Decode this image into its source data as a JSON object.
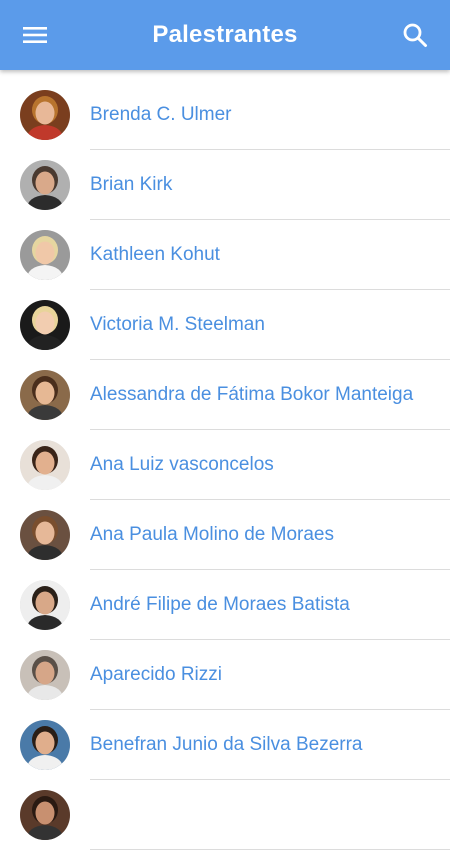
{
  "header": {
    "title": "Palestrantes",
    "menu_icon": "menu-icon",
    "search_icon": "search-icon",
    "bar_color": "#5b9bea"
  },
  "speakers": [
    {
      "name": "Brenda C. Ulmer",
      "avatar": {
        "bg": "#7a3e1e",
        "skin": "#e8b898",
        "hair": "#b8742e",
        "shirt": "#c0392b"
      }
    },
    {
      "name": "Brian Kirk",
      "avatar": {
        "bg": "#b0b0b0",
        "skin": "#d9a98a",
        "hair": "#4a3a30",
        "shirt": "#2c2c2c"
      }
    },
    {
      "name": "Kathleen Kohut",
      "avatar": {
        "bg": "#9a9a9a",
        "skin": "#f0c8a8",
        "hair": "#e6d6a0",
        "shirt": "#f4f4f4"
      }
    },
    {
      "name": "Victoria M. Steelman",
      "avatar": {
        "bg": "#1a1a1a",
        "skin": "#f2cdb0",
        "hair": "#e8d49a",
        "shirt": "#222222"
      }
    },
    {
      "name": "Alessandra de Fátima Bokor Manteiga",
      "avatar": {
        "bg": "#8a6a4a",
        "skin": "#e6b894",
        "hair": "#4a2e1c",
        "shirt": "#3a3a3a"
      }
    },
    {
      "name": "Ana Luiz vasconcelos",
      "avatar": {
        "bg": "#e8e0d8",
        "skin": "#e2b08e",
        "hair": "#3a2418",
        "shirt": "#f0f0f0"
      }
    },
    {
      "name": "Ana Paula Molino de Moraes",
      "avatar": {
        "bg": "#6a5040",
        "skin": "#e6b898",
        "hair": "#7a4e2e",
        "shirt": "#2e2e2e"
      }
    },
    {
      "name": "André Filipe de Moraes Batista",
      "avatar": {
        "bg": "#eeeeee",
        "skin": "#d8a888",
        "hair": "#2a2018",
        "shirt": "#2a2a2a"
      }
    },
    {
      "name": "Aparecido Rizzi",
      "avatar": {
        "bg": "#c8c0b8",
        "skin": "#d6a688",
        "hair": "#5a5048",
        "shirt": "#e8e8e8"
      }
    },
    {
      "name": "Benefran Junio da Silva Bezerra",
      "avatar": {
        "bg": "#4a7aa8",
        "skin": "#e0ae8c",
        "hair": "#2a1e16",
        "shirt": "#f0f0f0"
      }
    },
    {
      "name": "",
      "avatar": {
        "bg": "#5a3a2a",
        "skin": "#c89070",
        "hair": "#2a1a12",
        "shirt": "#333333"
      }
    }
  ]
}
